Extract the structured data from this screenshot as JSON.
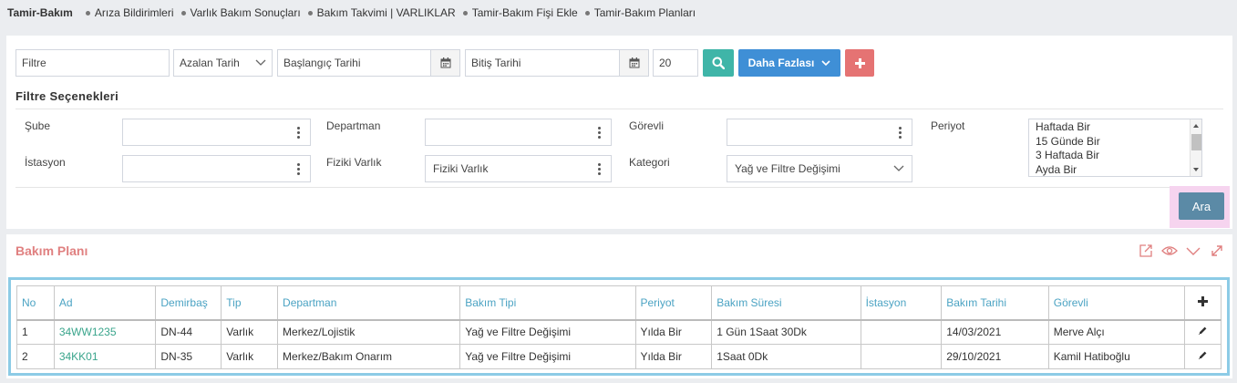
{
  "topnav": {
    "brand": "Tamir-Bakım",
    "links": [
      "Arıza Bildirimleri",
      "Varlık Bakım Sonuçları",
      "Bakım Takvimi | VARLIKLAR",
      "Tamir-Bakım Fişi Ekle",
      "Tamir-Bakım Planları"
    ]
  },
  "toolbar": {
    "filter_placeholder": "Filtre",
    "sort_value": "Azalan Tarih",
    "start_date_placeholder": "Başlangıç Tarihi",
    "end_date_placeholder": "Bitiş Tarihi",
    "page_size": "20",
    "more_label": "Daha Fazlası",
    "colors": {
      "search": "#3fb5a8",
      "more": "#3f8fd6",
      "add": "#e57373"
    }
  },
  "filters": {
    "title": "Filtre Seçenekleri",
    "sube_label": "Şube",
    "sube_value": "",
    "departman_label": "Departman",
    "departman_value": "",
    "gorevli_label": "Görevli",
    "gorevli_value": "",
    "periyot_label": "Periyot",
    "periyot_options": [
      "Haftada Bir",
      "15 Günde Bir",
      "3 Haftada Bir",
      "Ayda Bir"
    ],
    "istasyon_label": "İstasyon",
    "istasyon_value": "",
    "fiziki_label": "Fiziki Varlık",
    "fiziki_value": "Fiziki Varlık",
    "kategori_label": "Kategori",
    "kategori_value": "Yağ ve Filtre Değişimi",
    "ara_label": "Ara"
  },
  "plan": {
    "title": "Bakım Planı",
    "columns": [
      "No",
      "Ad",
      "Demirbaş",
      "Tip",
      "Departman",
      "Bakım Tipi",
      "Periyot",
      "Bakım Süresi",
      "İstasyon",
      "Bakım Tarihi",
      "Görevli"
    ],
    "add_symbol": "+",
    "rows": [
      {
        "no": "1",
        "ad": "34WW1235",
        "demirbas": "DN-44",
        "tip": "Varlık",
        "departman": "Merkez/Lojistik",
        "bakim_tipi": "Yağ ve Filtre Değişimi",
        "periyot": "Yılda Bir",
        "sure": "1 Gün 1Saat 30Dk",
        "istasyon": "",
        "tarih": "14/03/2021",
        "gorevli": "Merve Alçı"
      },
      {
        "no": "2",
        "ad": "34KK01",
        "demirbas": "DN-35",
        "tip": "Varlık",
        "departman": "Merkez/Bakım Onarım",
        "bakim_tipi": "Yağ ve Filtre Değişimi",
        "periyot": "Yılda Bir",
        "sure": "1Saat 0Dk",
        "istasyon": "",
        "tarih": "29/10/2021",
        "gorevli": "Kamil Hatiboğlu"
      }
    ]
  }
}
